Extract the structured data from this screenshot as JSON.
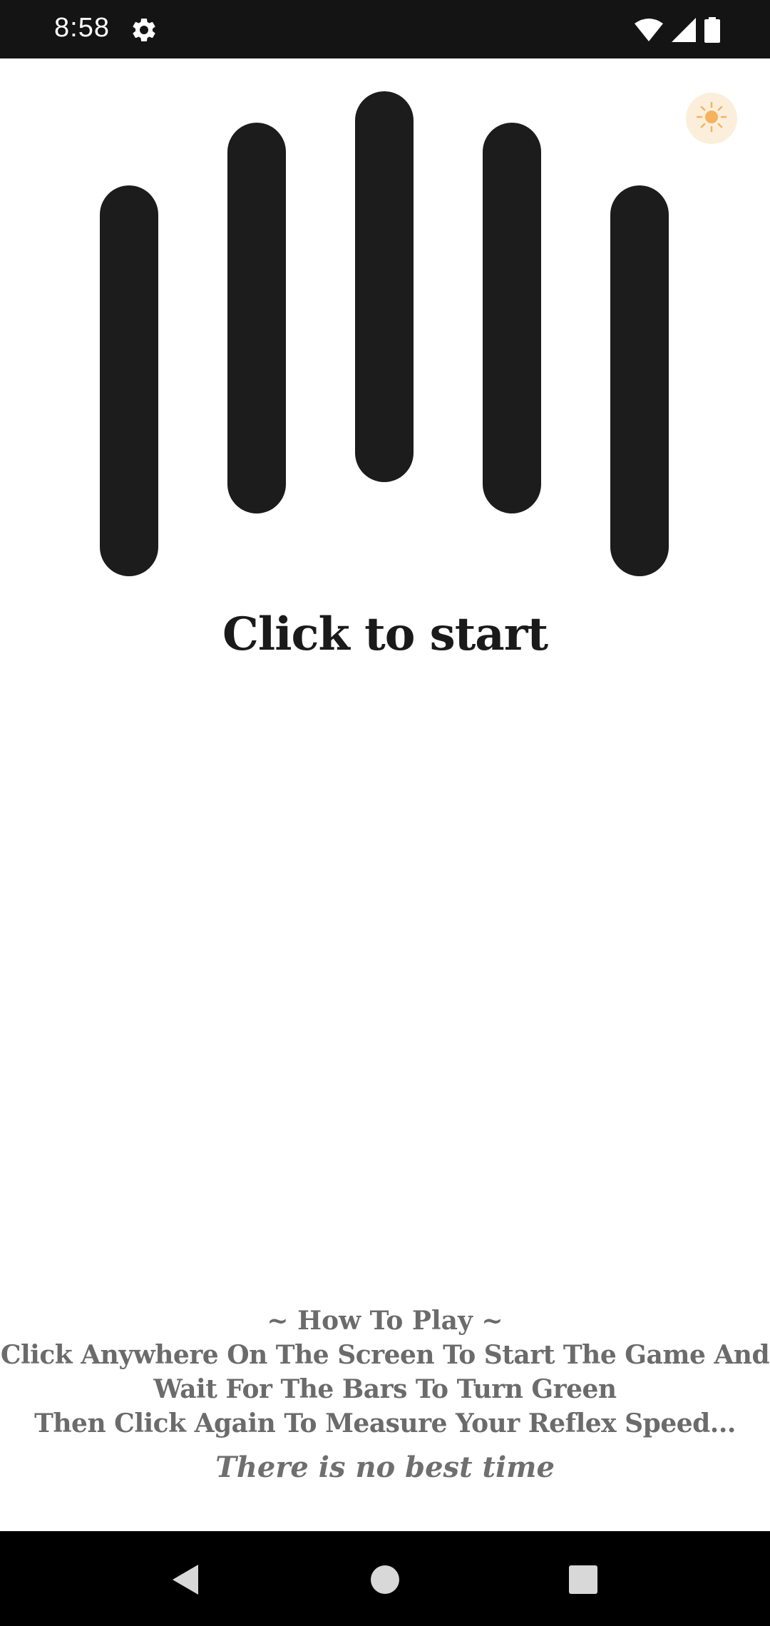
{
  "status_bar": {
    "time": "8:58",
    "icons": [
      "gear-icon",
      "wifi-icon",
      "signal-icon",
      "battery-icon"
    ]
  },
  "theme": {
    "toggle_icon": "sun-icon",
    "toggle_color": "#f6b35d",
    "toggle_bg": "#fbefdc",
    "bar_color": "#1c1c1c",
    "text_color": "#6b6b6b"
  },
  "bars": {
    "count": 5
  },
  "main": {
    "start_label": "Click to start"
  },
  "instructions": {
    "heading": "~ How To Play ~",
    "lines": [
      "Click Anywhere On The Screen To Start The Game And",
      "Wait For The Bars To Turn Green",
      "Then Click Again To Measure Your Reflex Speed..."
    ],
    "best_time": "There is no best time"
  },
  "nav_bar": {
    "buttons": [
      "back-icon",
      "home-icon",
      "recents-icon"
    ]
  }
}
